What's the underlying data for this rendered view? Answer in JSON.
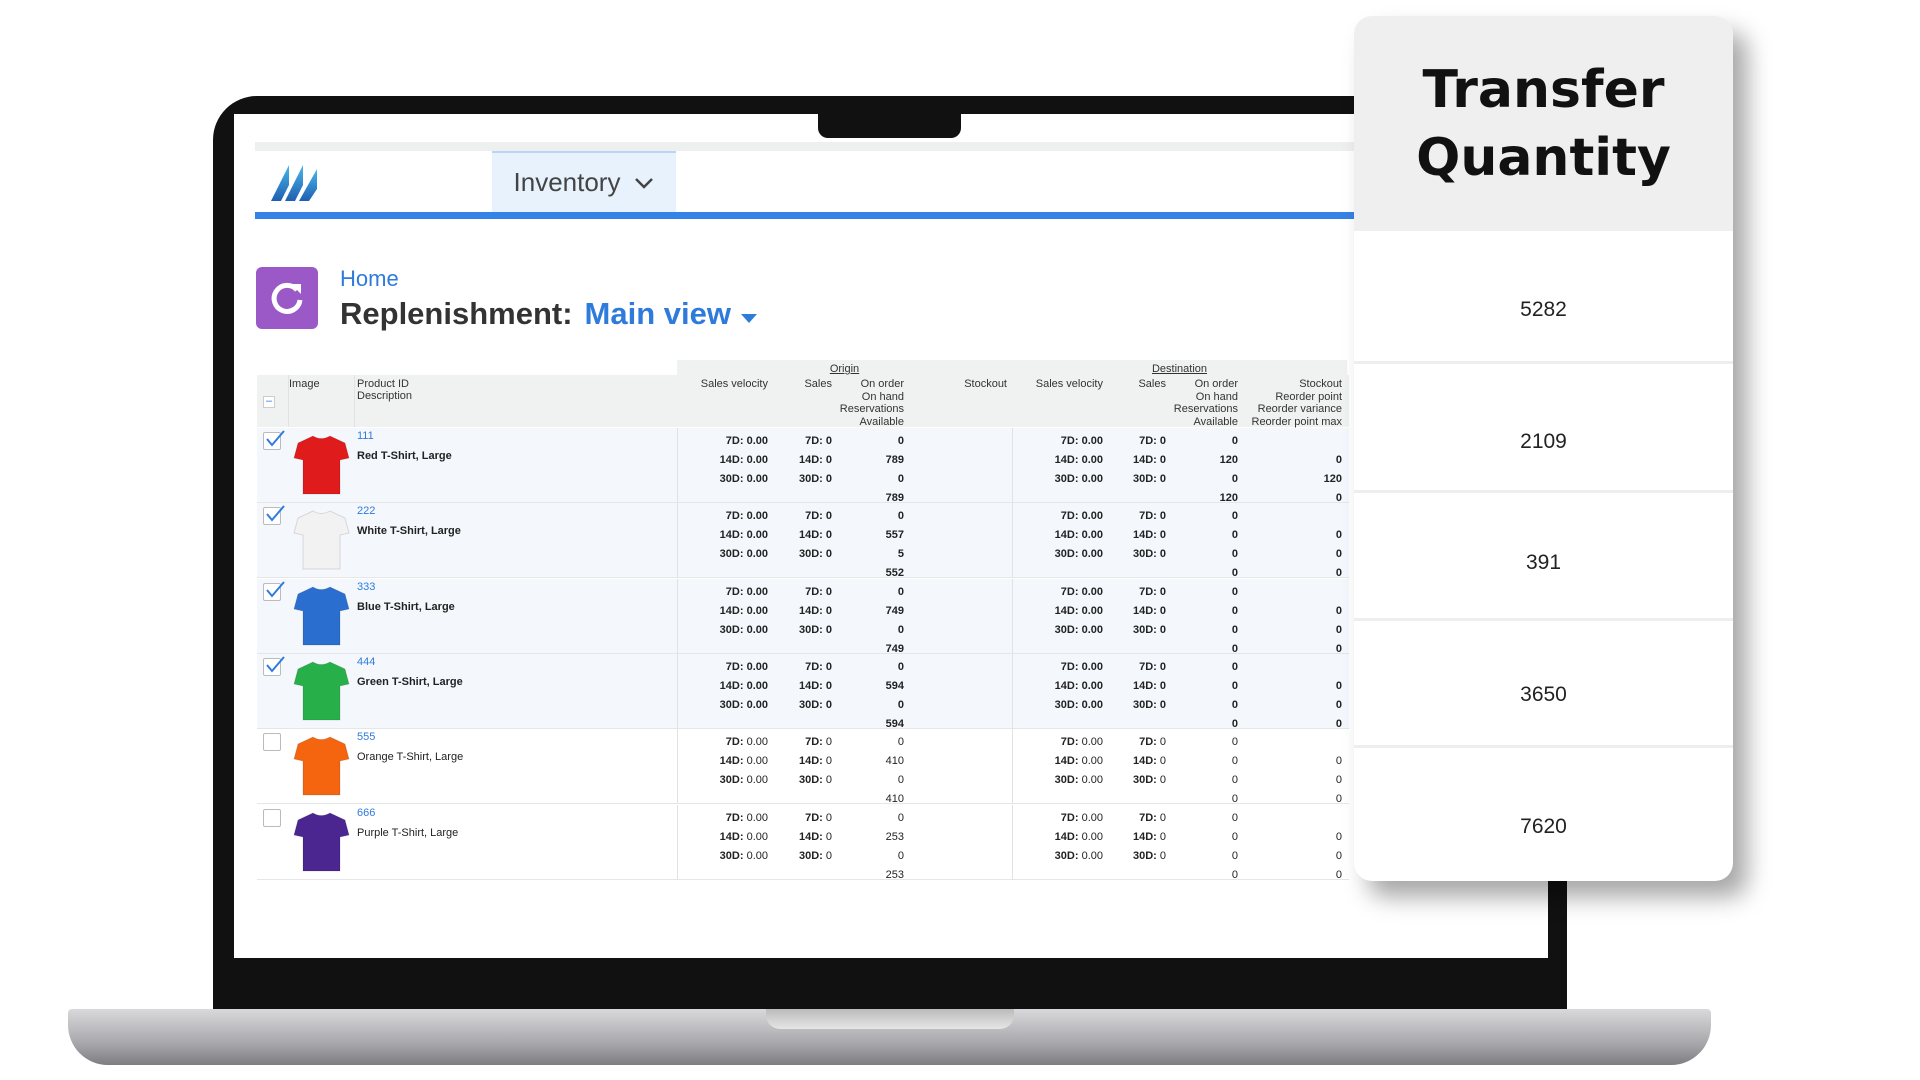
{
  "nav": {
    "menu_label": "Inventory"
  },
  "breadcrumb": {
    "home": "Home"
  },
  "page": {
    "title": "Replenishment:",
    "view": "Main view"
  },
  "colors": {
    "accent": "#3583e6",
    "link": "#2f7bdc",
    "app_icon": "#9b59c8"
  },
  "table": {
    "headers": {
      "image": "Image",
      "product": [
        "Product ID",
        "Description"
      ],
      "origin_group": "Origin",
      "destination_group": "Destination",
      "sales_velocity": "Sales velocity",
      "sales": "Sales",
      "onorder": [
        "On order",
        "On hand",
        "Reservations",
        "Available"
      ],
      "stockout": "Stockout",
      "dest_stockout": [
        "Stockout",
        "Reorder point",
        "Reorder variance",
        "Reorder point max"
      ]
    },
    "rows": [
      {
        "id": "111",
        "desc": "Red T-Shirt, Large",
        "color": "#e01b1b",
        "checked": true,
        "o_onorder": [
          "0",
          "789",
          "0",
          "789"
        ],
        "d_onorder": [
          "0",
          "120",
          "0",
          "120"
        ],
        "d_stock": [
          "",
          "0",
          "120",
          "0"
        ]
      },
      {
        "id": "222",
        "desc": "White T-Shirt, Large",
        "color": "#f2f2f2",
        "checked": true,
        "o_onorder": [
          "0",
          "557",
          "5",
          "552"
        ],
        "d_onorder": [
          "0",
          "0",
          "0",
          "0"
        ],
        "d_stock": [
          "",
          "0",
          "0",
          "0"
        ]
      },
      {
        "id": "333",
        "desc": "Blue T-Shirt, Large",
        "color": "#2a6fd0",
        "checked": true,
        "o_onorder": [
          "0",
          "749",
          "0",
          "749"
        ],
        "d_onorder": [
          "0",
          "0",
          "0",
          "0"
        ],
        "d_stock": [
          "",
          "0",
          "0",
          "0"
        ]
      },
      {
        "id": "444",
        "desc": "Green T-Shirt, Large",
        "color": "#27b04a",
        "checked": true,
        "o_onorder": [
          "0",
          "594",
          "0",
          "594"
        ],
        "d_onorder": [
          "0",
          "0",
          "0",
          "0"
        ],
        "d_stock": [
          "",
          "0",
          "0",
          "0"
        ]
      },
      {
        "id": "555",
        "desc": "Orange T-Shirt, Large",
        "color": "#f5650f",
        "checked": false,
        "o_onorder": [
          "0",
          "410",
          "0",
          "410"
        ],
        "d_onorder": [
          "0",
          "0",
          "0",
          "0"
        ],
        "d_stock": [
          "",
          "0",
          "0",
          "0"
        ]
      },
      {
        "id": "666",
        "desc": "Purple T-Shirt, Large",
        "color": "#4b2590",
        "checked": false,
        "o_onorder": [
          "0",
          "253",
          "0",
          "253"
        ],
        "d_onorder": [
          "0",
          "0",
          "0",
          "0"
        ],
        "d_stock": [
          "",
          "0",
          "0",
          "0"
        ]
      }
    ],
    "velocity": [
      [
        "7D:",
        "0.00"
      ],
      [
        "14D:",
        "0.00"
      ],
      [
        "30D:",
        "0.00"
      ]
    ],
    "sales": [
      [
        "7D:",
        "0"
      ],
      [
        "14D:",
        "0"
      ],
      [
        "30D:",
        "0"
      ]
    ]
  },
  "transfer": {
    "title": "Transfer Quantity",
    "values": [
      "5282",
      "2109",
      "391",
      "3650",
      "7620"
    ]
  }
}
